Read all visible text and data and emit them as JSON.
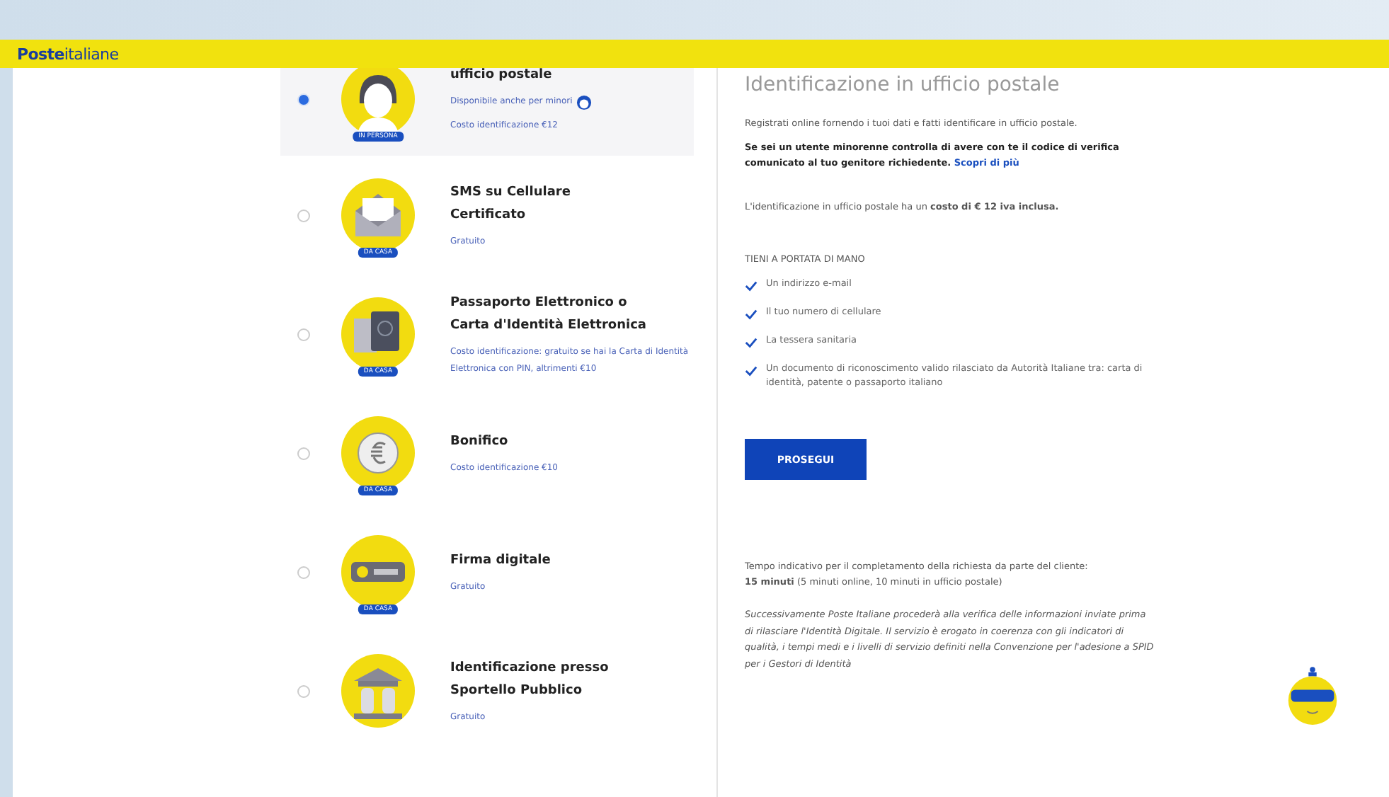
{
  "header": {
    "logo": {
      "bold": "Poste",
      "light": "italiane"
    }
  },
  "methods": [
    {
      "title": "ufficio postale",
      "badge": "IN PERSONA",
      "lines": [
        "Disponibile anche per minori",
        "Costo identificazione €12"
      ],
      "minor_icon": true,
      "selected": true
    },
    {
      "title": "SMS su Cellulare Certificato",
      "badge": "DA CASA",
      "lines": [
        "Gratuito"
      ],
      "minor_icon": false,
      "selected": false
    },
    {
      "title": "Passaporto Elettronico o Carta d'Identità Elettronica",
      "badge": "DA CASA",
      "lines": [
        "Costo identificazione: gratuito se hai la Carta di Identità Elettronica con PIN, altrimenti €10"
      ],
      "minor_icon": false,
      "selected": false
    },
    {
      "title": "Bonifico",
      "badge": "DA CASA",
      "lines": [
        "Costo identificazione €10"
      ],
      "minor_icon": false,
      "selected": false
    },
    {
      "title": "Firma digitale",
      "badge": "DA CASA",
      "lines": [
        "Gratuito"
      ],
      "minor_icon": false,
      "selected": false
    },
    {
      "title": "Identificazione presso Sportello Pubblico",
      "lines": [
        "Gratuito"
      ],
      "minor_icon": false,
      "selected": false
    }
  ],
  "detail": {
    "title": "Identificazione in ufficio postale",
    "intro": "Registrati online fornendo i tuoi dati e fatti identificare in ufficio postale.",
    "minor_note": "Se sei un utente minorenne controlla di avere con te il codice di verifica comunicato al tuo genitore richiedente.",
    "minor_link": "Scopri di più",
    "cost": "L'identificazione in ufficio postale ha un **costo di € 12 iva inclusa.**",
    "checklist_title": "TIENI A PORTATA DI MANO",
    "checklist": [
      "Un indirizzo e-mail",
      "Il tuo numero di cellulare",
      "La tessera sanitaria",
      "Un documento di riconoscimento valido rilasciato da Autorità Italiane tra: carta di identità, patente o passaporto italiano"
    ],
    "button": "PROSEGUI",
    "time_note": "Tempo indicativo per il completamento della richiesta da parte del cliente:",
    "time_value": "**15 minuti** (5 minuti online, 10 minuti in ufficio postale)",
    "disclaimer": "Successivamente Poste Italiane procederà alla verifica delle informazioni inviate prima di rilasciare l'Identità Digitale. Il servizio è erogato in coerenza con gli indicatori di qualità, i tempi medi e i livelli di servizio definiti nella Convenzione per l'adesione a SPID per i Gestori di Identità"
  }
}
